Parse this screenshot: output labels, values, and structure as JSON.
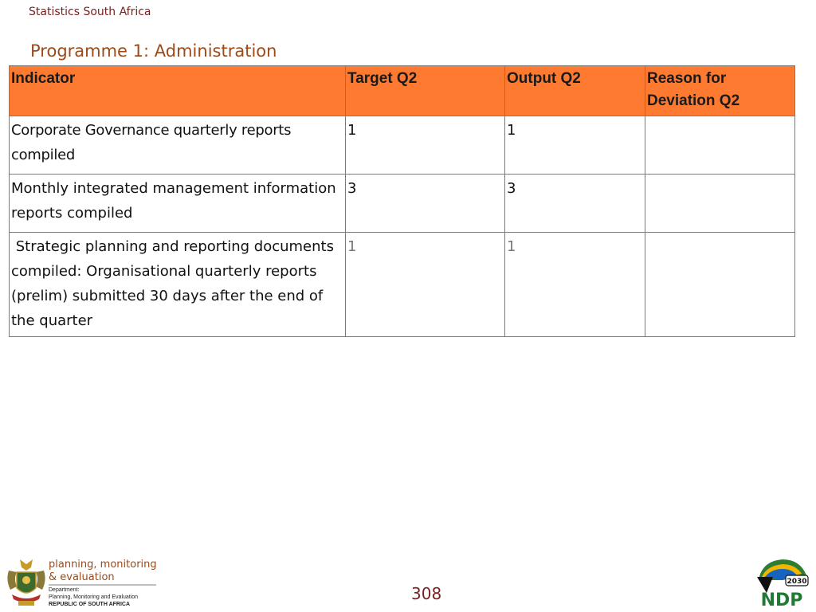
{
  "header": {
    "org_name": "Statistics South Africa",
    "title": "Programme 1: Administration"
  },
  "table": {
    "headers": [
      "Indicator",
      "Target Q2",
      "Output Q2",
      "Reason for Deviation Q2"
    ],
    "rows": [
      [
        "Corporate Governance quarterly reports compiled",
        "1",
        "1",
        ""
      ],
      [
        "Monthly integrated management information reports compiled",
        "3",
        "3",
        ""
      ],
      [
        " Strategic planning and reporting documents compiled: Organisational quarterly reports (prelim) submitted 30 days after the end of the quarter",
        "1",
        "1",
        ""
      ]
    ]
  },
  "footer": {
    "page_number": "308",
    "dpme_logo": {
      "line1": "planning, monitoring",
      "line2": "& evaluation",
      "dept_line1": "Department:",
      "dept_line2": "Planning, Monitoring and Evaluation",
      "country": "REPUBLIC OF SOUTH AFRICA"
    },
    "ndp_logo": {
      "year": "2030",
      "text": "NDP"
    }
  },
  "colors": {
    "header_fill": "#fd7a30",
    "title": "#9c4a1a",
    "org_name": "#7a1e1e",
    "page_number": "#7a1e1e"
  }
}
